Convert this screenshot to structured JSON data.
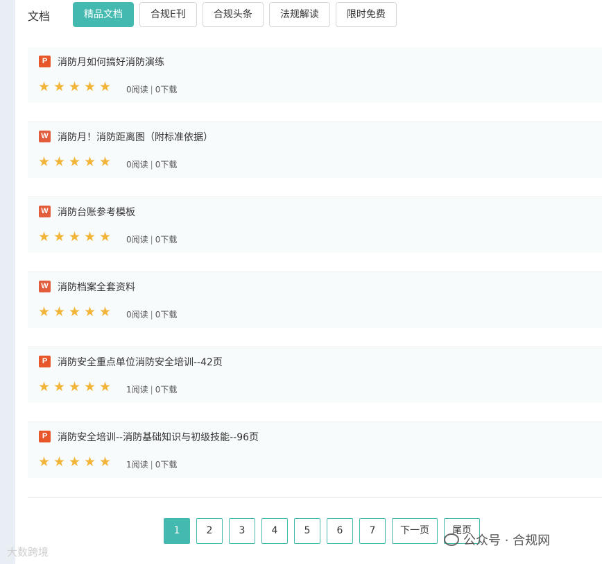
{
  "section": {
    "title": "文档"
  },
  "tabs": [
    {
      "label": "精品文档",
      "active": true
    },
    {
      "label": "合规E刊",
      "active": false
    },
    {
      "label": "合规头条",
      "active": false
    },
    {
      "label": "法规解读",
      "active": false
    },
    {
      "label": "限时免费",
      "active": false
    }
  ],
  "documents": [
    {
      "icon": "ppt-icon",
      "icon_text": "P",
      "title": "消防月如何搞好消防演练",
      "rating": 5,
      "reads": "0阅读",
      "sep": "|",
      "downloads": "0下载"
    },
    {
      "icon": "word-icon",
      "icon_text": "W",
      "title": "消防月！消防距离图（附标准依据）",
      "rating": 5,
      "reads": "0阅读",
      "sep": "|",
      "downloads": "0下载"
    },
    {
      "icon": "word-icon",
      "icon_text": "W",
      "title": "消防台账参考模板",
      "rating": 5,
      "reads": "0阅读",
      "sep": "|",
      "downloads": "0下载"
    },
    {
      "icon": "word-icon",
      "icon_text": "W",
      "title": "消防档案全套资料",
      "rating": 5,
      "reads": "0阅读",
      "sep": "|",
      "downloads": "0下载"
    },
    {
      "icon": "ppt-icon",
      "icon_text": "P",
      "title": "消防安全重点单位消防安全培训--42页",
      "rating": 5,
      "reads": "1阅读",
      "sep": "|",
      "downloads": "0下载"
    },
    {
      "icon": "ppt-icon",
      "icon_text": "P",
      "title": "消防安全培训--消防基础知识与初级技能--96页",
      "rating": 5,
      "reads": "1阅读",
      "sep": "|",
      "downloads": "0下载"
    }
  ],
  "pagination": {
    "pages": [
      "1",
      "2",
      "3",
      "4",
      "5",
      "6",
      "7"
    ],
    "current": "1",
    "next": "下一页",
    "last": "尾页"
  },
  "overlay": {
    "wechat_label": "公众号 · 合规网",
    "watermark": "大数跨境"
  },
  "colors": {
    "accent": "#44b9b0",
    "star": "#f2b53a",
    "ppt": "#e8572a",
    "word": "#e35d3c"
  }
}
